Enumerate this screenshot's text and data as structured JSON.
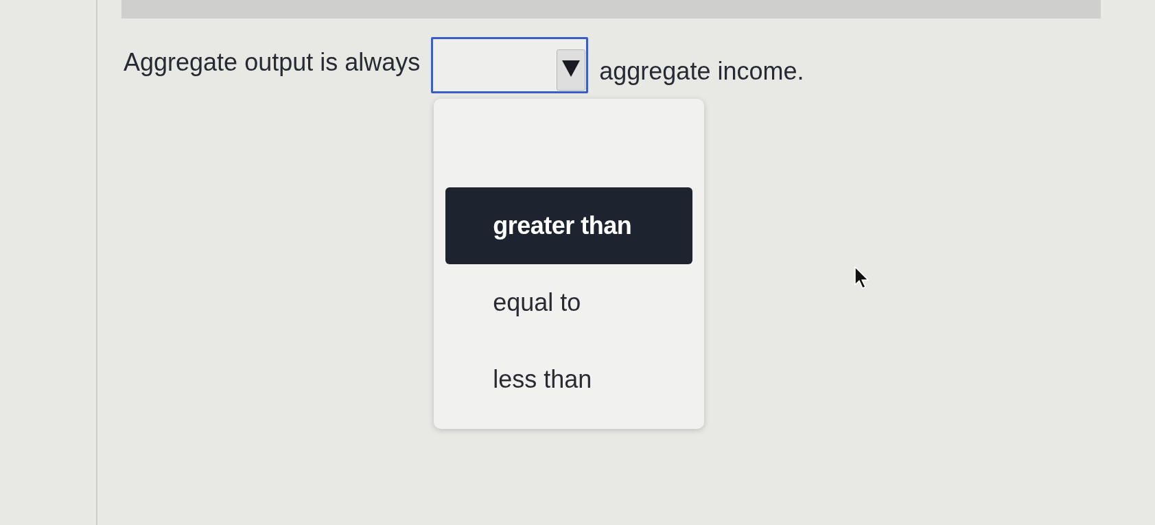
{
  "question": {
    "before": "Aggregate output is always",
    "after": "aggregate income."
  },
  "dropdown": {
    "expanded": true,
    "options": [
      {
        "label": "greater than",
        "selected": true
      },
      {
        "label": "equal to",
        "selected": false
      },
      {
        "label": "less than",
        "selected": false
      }
    ]
  }
}
